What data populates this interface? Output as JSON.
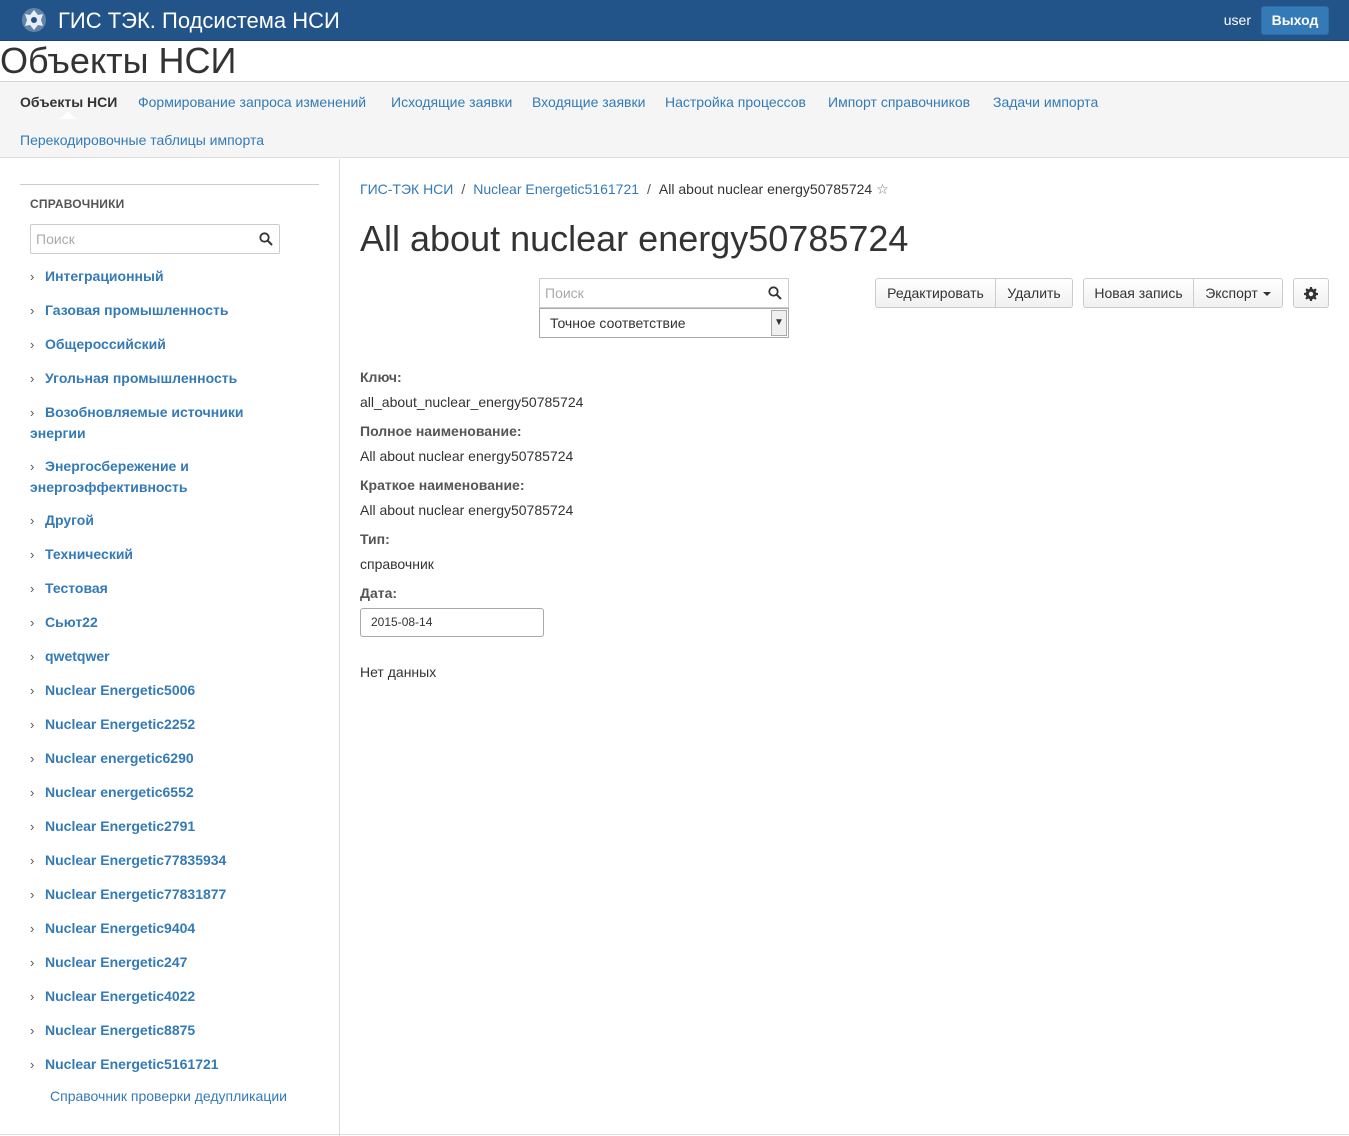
{
  "topbar": {
    "title": "ГИС ТЭК. Подсистема НСИ",
    "user": "user",
    "logout_label": "Выход",
    "emblem_icon": "coat-of-arms-icon"
  },
  "page": {
    "title": "Объекты НСИ"
  },
  "subnav": {
    "items": [
      "Объекты НСИ",
      "Формирование запроса изменений",
      "Исходящие заявки",
      "Входящие заявки",
      "Настройка процессов",
      "Импорт справочников",
      "Задачи импорта",
      "Перекодировочные таблицы импорта"
    ],
    "active_index": 0
  },
  "sidebar": {
    "section_title": "Справочники",
    "search_placeholder": "Поиск",
    "items": [
      "Интеграционный",
      "Газовая промышленность",
      "Общероссийский",
      "Угольная промышленность",
      "Возобновляемые источники энергии",
      "Энергосбережение и энергоэффективность",
      "Другой",
      "Технический",
      "Тестовая",
      "Сьют22",
      "qwetqwer",
      "Nuclear Energetic5006",
      "Nuclear Energetic2252",
      "Nuclear energetic6290",
      "Nuclear energetic6552",
      "Nuclear Energetic2791",
      "Nuclear Energetic77835934",
      "Nuclear Energetic77831877",
      "Nuclear Energetic9404",
      "Nuclear Energetic247",
      "Nuclear Energetic4022",
      "Nuclear Energetic8875",
      "Nuclear Energetic5161721"
    ],
    "leaf_item": "Справочник проверки дедупликации"
  },
  "main": {
    "breadcrumb": [
      "ГИС-ТЭК НСИ",
      "Nuclear Energetic5161721",
      "All about nuclear energy50785724"
    ],
    "title": "All about nuclear energy50785724",
    "search_placeholder": "Поиск",
    "match_mode": "Точное соответствие",
    "buttons": {
      "edit": "Редактировать",
      "delete": "Удалить",
      "new_record": "Новая запись",
      "export": "Экспорт"
    },
    "fields": [
      {
        "label": "Ключ:",
        "value": "all_about_nuclear_energy50785724"
      },
      {
        "label": "Полное наименование:",
        "value": "All about nuclear energy50785724"
      },
      {
        "label": "Краткое наименование:",
        "value": "All about nuclear energy50785724"
      },
      {
        "label": "Тип:",
        "value": "справочник"
      },
      {
        "label": "Дата:",
        "value": "2015-08-14"
      }
    ],
    "no_data": "Нет данных"
  }
}
